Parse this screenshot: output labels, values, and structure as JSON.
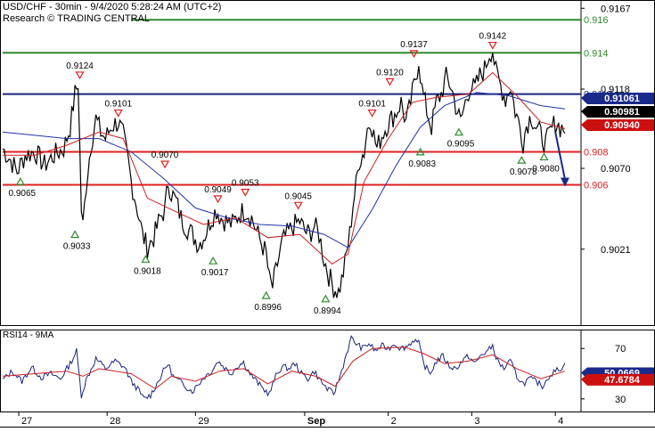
{
  "header": {
    "title": "USD/CHF - 30min - 9/4/2020 5:28:24 AM (UTC+2)",
    "research": "Research © TRADING CENTRAL"
  },
  "chart_data": [
    {
      "type": "line",
      "name": "price-panel",
      "ylim": [
        0.8975,
        0.9172
      ],
      "bar_count": 290,
      "y_ticks": [
        {
          "value": 0.9167,
          "label": "0.9167"
        },
        {
          "value": 0.9118,
          "label": "0.9118"
        },
        {
          "value": 0.907,
          "label": "0.9070"
        },
        {
          "value": 0.9021,
          "label": "0.9021"
        }
      ],
      "x_ticks": [
        {
          "bar": 10,
          "label": "27"
        },
        {
          "bar": 65,
          "label": "28"
        },
        {
          "bar": 120,
          "label": "29"
        },
        {
          "bar": 188,
          "label": "Sep"
        },
        {
          "bar": 240,
          "label": "2"
        },
        {
          "bar": 292,
          "label": "3"
        },
        {
          "bar": 344,
          "label": "4"
        }
      ],
      "levels": [
        {
          "value": 0.916,
          "label": "0.916",
          "color": "#2e8b2e",
          "x_start_bar": 80
        },
        {
          "value": 0.914,
          "label": "0.914",
          "color": "#2e8b2e",
          "x_start_bar": 0
        },
        {
          "value": 0.9115,
          "label": "0.9115",
          "color": "#1a237e",
          "x_start_bar": 0
        },
        {
          "value": 0.908,
          "label": "0.908",
          "color": "#e02020",
          "x_start_bar": 0
        },
        {
          "value": 0.906,
          "label": "0.906",
          "color": "#e02020",
          "x_start_bar": 0
        }
      ],
      "price_badges": [
        {
          "value": 0.91061,
          "label": "0.91061",
          "bg": "#1a2a8a",
          "fg": "#ffffff"
        },
        {
          "value": 0.90981,
          "label": "0.90981",
          "bg": "#000000",
          "fg": "#ffffff"
        },
        {
          "value": 0.9094,
          "label": "0.90940",
          "bg": "#cc1010",
          "fg": "#ffffff"
        }
      ],
      "close_points": [
        [
          0,
          0.9082
        ],
        [
          5,
          0.9075
        ],
        [
          9,
          0.9068
        ],
        [
          14,
          0.9078
        ],
        [
          20,
          0.908
        ],
        [
          26,
          0.9072
        ],
        [
          32,
          0.9078
        ],
        [
          38,
          0.9082
        ],
        [
          42,
          0.9095
        ],
        [
          45,
          0.9115
        ],
        [
          47,
          0.9122
        ],
        [
          49,
          0.9045
        ],
        [
          50,
          0.9035
        ],
        [
          52,
          0.906
        ],
        [
          55,
          0.9085
        ],
        [
          58,
          0.91
        ],
        [
          61,
          0.9092
        ],
        [
          64,
          0.9088
        ],
        [
          68,
          0.9096
        ],
        [
          72,
          0.9098
        ],
        [
          75,
          0.909
        ],
        [
          78,
          0.9075
        ],
        [
          80,
          0.9062
        ],
        [
          84,
          0.9045
        ],
        [
          87,
          0.903
        ],
        [
          90,
          0.9022
        ],
        [
          94,
          0.9028
        ],
        [
          98,
          0.904
        ],
        [
          101,
          0.9045
        ],
        [
          103,
          0.9062
        ],
        [
          105,
          0.9055
        ],
        [
          108,
          0.905
        ],
        [
          111,
          0.904
        ],
        [
          114,
          0.9035
        ],
        [
          118,
          0.903
        ],
        [
          122,
          0.9024
        ],
        [
          126,
          0.903
        ],
        [
          130,
          0.904
        ],
        [
          133,
          0.9045
        ],
        [
          136,
          0.904
        ],
        [
          139,
          0.9038
        ],
        [
          143,
          0.9036
        ],
        [
          147,
          0.9042
        ],
        [
          151,
          0.9045
        ],
        [
          155,
          0.904
        ],
        [
          158,
          0.9032
        ],
        [
          161,
          0.9025
        ],
        [
          164,
          0.9018
        ],
        [
          166,
          0.9002
        ],
        [
          168,
          0.8998
        ],
        [
          171,
          0.9012
        ],
        [
          174,
          0.9025
        ],
        [
          177,
          0.903
        ],
        [
          181,
          0.9035
        ],
        [
          185,
          0.9038
        ],
        [
          188,
          0.9032
        ],
        [
          191,
          0.903
        ],
        [
          194,
          0.9035
        ],
        [
          197,
          0.903
        ],
        [
          200,
          0.9015
        ],
        [
          203,
          0.9005
        ],
        [
          206,
          0.8998
        ],
        [
          209,
          0.8995
        ],
        [
          211,
          0.9002
        ],
        [
          213,
          0.9012
        ],
        [
          216,
          0.903
        ],
        [
          218,
          0.9048
        ],
        [
          220,
          0.906
        ],
        [
          222,
          0.9075
        ],
        [
          225,
          0.908
        ],
        [
          227,
          0.9094
        ],
        [
          229,
          0.91
        ],
        [
          231,
          0.909
        ],
        [
          233,
          0.9082
        ],
        [
          236,
          0.909
        ],
        [
          239,
          0.9096
        ],
        [
          242,
          0.91
        ],
        [
          245,
          0.9104
        ],
        [
          248,
          0.911
        ],
        [
          251,
          0.9098
        ],
        [
          253,
          0.9105
        ],
        [
          256,
          0.912
        ],
        [
          258,
          0.913
        ],
        [
          259,
          0.9136
        ],
        [
          261,
          0.9118
        ],
        [
          264,
          0.9105
        ],
        [
          267,
          0.9095
        ],
        [
          270,
          0.911
        ],
        [
          273,
          0.9115
        ],
        [
          276,
          0.9125
        ],
        [
          279,
          0.912
        ],
        [
          282,
          0.9108
        ],
        [
          285,
          0.9098
        ],
        [
          288,
          0.911
        ],
        [
          291,
          0.912
        ],
        [
          294,
          0.9118
        ],
        [
          297,
          0.9126
        ],
        [
          300,
          0.913
        ],
        [
          303,
          0.914
        ],
        [
          305,
          0.9142
        ],
        [
          307,
          0.9128
        ],
        [
          310,
          0.912
        ],
        [
          313,
          0.9112
        ],
        [
          316,
          0.912
        ],
        [
          319,
          0.9105
        ],
        [
          322,
          0.9095
        ],
        [
          324,
          0.9086
        ],
        [
          326,
          0.9096
        ],
        [
          329,
          0.9102
        ],
        [
          332,
          0.9095
        ],
        [
          335,
          0.909
        ],
        [
          338,
          0.9085
        ],
        [
          341,
          0.9092
        ],
        [
          344,
          0.9098
        ],
        [
          347,
          0.9095
        ],
        [
          350,
          0.9094
        ]
      ],
      "ema_red_points": [
        [
          0,
          0.9078
        ],
        [
          20,
          0.9078
        ],
        [
          40,
          0.9084
        ],
        [
          60,
          0.9092
        ],
        [
          75,
          0.9088
        ],
        [
          90,
          0.9052
        ],
        [
          105,
          0.9045
        ],
        [
          125,
          0.9036
        ],
        [
          145,
          0.904
        ],
        [
          165,
          0.9028
        ],
        [
          185,
          0.903
        ],
        [
          205,
          0.9012
        ],
        [
          215,
          0.9018
        ],
        [
          225,
          0.9062
        ],
        [
          240,
          0.9088
        ],
        [
          255,
          0.911
        ],
        [
          270,
          0.9113
        ],
        [
          290,
          0.9115
        ],
        [
          305,
          0.9128
        ],
        [
          320,
          0.9114
        ],
        [
          335,
          0.9098
        ],
        [
          350,
          0.9094
        ]
      ],
      "ema_blue_points": [
        [
          0,
          0.9092
        ],
        [
          20,
          0.909
        ],
        [
          40,
          0.9088
        ],
        [
          60,
          0.9088
        ],
        [
          80,
          0.908
        ],
        [
          100,
          0.9064
        ],
        [
          120,
          0.9046
        ],
        [
          140,
          0.904
        ],
        [
          160,
          0.9036
        ],
        [
          180,
          0.9035
        ],
        [
          200,
          0.903
        ],
        [
          215,
          0.9022
        ],
        [
          230,
          0.9045
        ],
        [
          245,
          0.9072
        ],
        [
          260,
          0.9095
        ],
        [
          275,
          0.9108
        ],
        [
          295,
          0.9116
        ],
        [
          315,
          0.9114
        ],
        [
          335,
          0.9108
        ],
        [
          350,
          0.9106
        ]
      ],
      "forecast_arrow": {
        "from": [
          344,
          0.9092
        ],
        "to": [
          350,
          0.906
        ],
        "color": "#1a2a8a"
      },
      "annotations": [
        {
          "bar": 48,
          "value": 0.9124,
          "label": "0.9124",
          "marker": "top"
        },
        {
          "bar": 72,
          "value": 0.9101,
          "label": "0.9101",
          "marker": "top"
        },
        {
          "bar": 101,
          "value": 0.907,
          "label": "0.9070",
          "marker": "top"
        },
        {
          "bar": 134,
          "value": 0.9049,
          "label": "0.9049",
          "marker": "top"
        },
        {
          "bar": 151,
          "value": 0.9053,
          "label": "0.9053",
          "marker": "top"
        },
        {
          "bar": 184,
          "value": 0.9045,
          "label": "0.9045",
          "marker": "top"
        },
        {
          "bar": 230,
          "value": 0.9101,
          "label": "0.9101",
          "marker": "top"
        },
        {
          "bar": 241,
          "value": 0.912,
          "label": "0.9120",
          "marker": "top"
        },
        {
          "bar": 256,
          "value": 0.9137,
          "label": "0.9137",
          "marker": "top"
        },
        {
          "bar": 305,
          "value": 0.9142,
          "label": "0.9142",
          "marker": "top"
        },
        {
          "bar": 11,
          "value": 0.9065,
          "label": "0.9065",
          "marker": "bottom"
        },
        {
          "bar": 45,
          "value": 0.9033,
          "label": "0.9033",
          "marker": "bottom"
        },
        {
          "bar": 89,
          "value": 0.9018,
          "label": "0.9018",
          "marker": "bottom"
        },
        {
          "bar": 131,
          "value": 0.9017,
          "label": "0.9017",
          "marker": "bottom"
        },
        {
          "bar": 164,
          "value": 0.8996,
          "label": "0.8996",
          "marker": "bottom"
        },
        {
          "bar": 201,
          "value": 0.8994,
          "label": "0.8994",
          "marker": "bottom"
        },
        {
          "bar": 260,
          "value": 0.9083,
          "label": "0.9083",
          "marker": "bottom"
        },
        {
          "bar": 284,
          "value": 0.9095,
          "label": "0.9095",
          "marker": "bottom"
        },
        {
          "bar": 323,
          "value": 0.9078,
          "label": "0.9078",
          "marker": "bottom"
        },
        {
          "bar": 337,
          "value": 0.908,
          "label": "0.9080",
          "marker": "bottom"
        }
      ]
    },
    {
      "type": "line",
      "name": "rsi-panel",
      "title": "RSI14 - 9MA",
      "ylim": [
        20,
        85
      ],
      "y_ticks": [
        {
          "value": 70,
          "label": "70"
        },
        {
          "value": 30,
          "label": "30"
        }
      ],
      "rsi_points": [
        [
          0,
          45
        ],
        [
          6,
          52
        ],
        [
          12,
          44
        ],
        [
          18,
          55
        ],
        [
          24,
          47
        ],
        [
          30,
          50
        ],
        [
          36,
          46
        ],
        [
          42,
          58
        ],
        [
          46,
          68
        ],
        [
          49,
          33
        ],
        [
          52,
          45
        ],
        [
          58,
          62
        ],
        [
          64,
          54
        ],
        [
          70,
          60
        ],
        [
          76,
          55
        ],
        [
          80,
          44
        ],
        [
          84,
          38
        ],
        [
          88,
          30
        ],
        [
          92,
          33
        ],
        [
          96,
          42
        ],
        [
          100,
          52
        ],
        [
          103,
          58
        ],
        [
          106,
          48
        ],
        [
          110,
          44
        ],
        [
          114,
          40
        ],
        [
          118,
          36
        ],
        [
          122,
          42
        ],
        [
          126,
          48
        ],
        [
          130,
          52
        ],
        [
          134,
          60
        ],
        [
          138,
          55
        ],
        [
          142,
          50
        ],
        [
          146,
          56
        ],
        [
          150,
          59
        ],
        [
          154,
          50
        ],
        [
          158,
          44
        ],
        [
          162,
          38
        ],
        [
          166,
          34
        ],
        [
          170,
          48
        ],
        [
          174,
          56
        ],
        [
          178,
          54
        ],
        [
          182,
          58
        ],
        [
          186,
          50
        ],
        [
          190,
          46
        ],
        [
          194,
          52
        ],
        [
          198,
          44
        ],
        [
          202,
          38
        ],
        [
          206,
          34
        ],
        [
          210,
          48
        ],
        [
          214,
          66
        ],
        [
          217,
          78
        ],
        [
          220,
          74
        ],
        [
          224,
          70
        ],
        [
          228,
          74
        ],
        [
          232,
          68
        ],
        [
          236,
          72
        ],
        [
          240,
          70
        ],
        [
          244,
          74
        ],
        [
          248,
          70
        ],
        [
          252,
          72
        ],
        [
          256,
          77
        ],
        [
          259,
          74
        ],
        [
          262,
          58
        ],
        [
          266,
          50
        ],
        [
          270,
          60
        ],
        [
          274,
          64
        ],
        [
          278,
          56
        ],
        [
          282,
          54
        ],
        [
          286,
          60
        ],
        [
          290,
          64
        ],
        [
          294,
          58
        ],
        [
          298,
          65
        ],
        [
          302,
          68
        ],
        [
          305,
          72
        ],
        [
          308,
          60
        ],
        [
          312,
          54
        ],
        [
          316,
          60
        ],
        [
          320,
          48
        ],
        [
          324,
          42
        ],
        [
          328,
          46
        ],
        [
          332,
          44
        ],
        [
          336,
          40
        ],
        [
          340,
          48
        ],
        [
          344,
          52
        ],
        [
          348,
          55
        ],
        [
          350,
          57
        ]
      ],
      "ma_points": [
        [
          0,
          48
        ],
        [
          20,
          50
        ],
        [
          40,
          52
        ],
        [
          50,
          48
        ],
        [
          60,
          54
        ],
        [
          80,
          50
        ],
        [
          95,
          38
        ],
        [
          105,
          48
        ],
        [
          120,
          44
        ],
        [
          135,
          52
        ],
        [
          150,
          54
        ],
        [
          165,
          42
        ],
        [
          180,
          52
        ],
        [
          195,
          48
        ],
        [
          207,
          40
        ],
        [
          218,
          60
        ],
        [
          230,
          70
        ],
        [
          250,
          71
        ],
        [
          262,
          66
        ],
        [
          275,
          58
        ],
        [
          290,
          60
        ],
        [
          305,
          65
        ],
        [
          320,
          54
        ],
        [
          335,
          46
        ],
        [
          350,
          52
        ]
      ],
      "badges": [
        {
          "value": 50.0669,
          "label": "50.0669",
          "bg": "#1a2a8a",
          "fg": "#ffffff"
        },
        {
          "value": 47.6784,
          "label": "47.6784",
          "bg": "#cc1010",
          "fg": "#ffffff"
        }
      ]
    }
  ],
  "colors": {
    "price_line": "#000000",
    "ema_red": "#cc2020",
    "ema_blue": "#2233aa",
    "marker_top": "#e02020",
    "marker_bottom": "#2e8b2e",
    "rsi_line": "#1a237e",
    "rsi_ma": "#cc2020",
    "axis": "#000000"
  }
}
